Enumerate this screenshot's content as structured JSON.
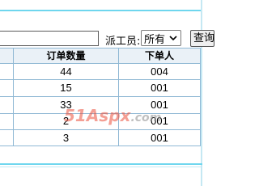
{
  "filter": {
    "text_value": "",
    "worker_label": "派工员:",
    "worker_select_value": "所有",
    "query_button_label": "查询"
  },
  "table": {
    "headers": [
      "订单数量",
      "下单人"
    ],
    "rows": [
      {
        "order_count": "44",
        "orderer": "004"
      },
      {
        "order_count": "15",
        "orderer": "001"
      },
      {
        "order_count": "33",
        "orderer": "001"
      },
      {
        "order_count": "2",
        "orderer": "001"
      },
      {
        "order_count": "3",
        "orderer": "001"
      }
    ]
  },
  "watermark": {
    "text": "51Aspx",
    "suffix": ".com"
  },
  "colors": {
    "frame": "#6fd6ee",
    "grid_line": "#8fb8d4",
    "header_bg": "#eaf1f7",
    "watermark": "#eb503c"
  }
}
